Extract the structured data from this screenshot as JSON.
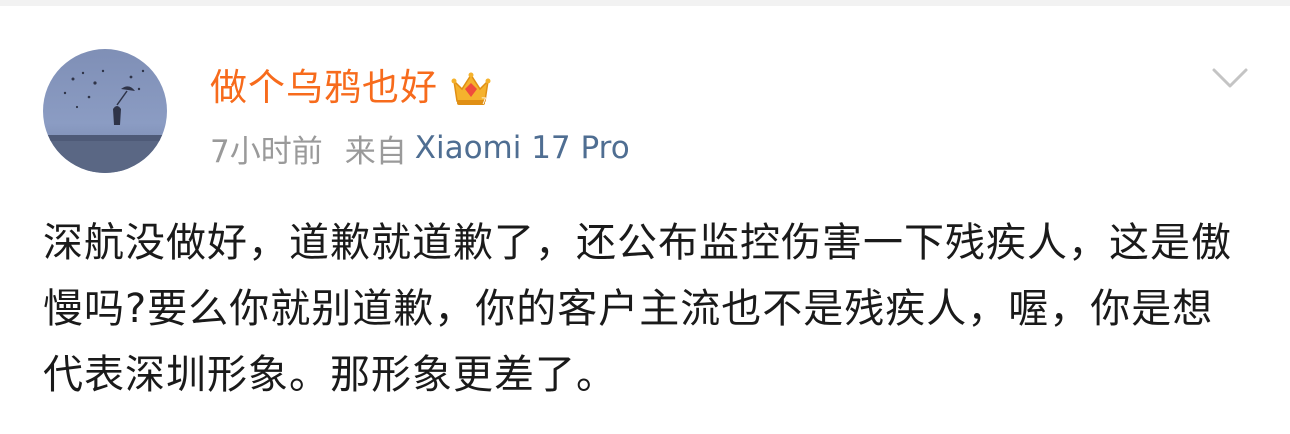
{
  "post": {
    "author": {
      "name": "做个乌鸦也好",
      "avatar": "avatar-image",
      "badge_icon": "crown-icon"
    },
    "meta": {
      "time": "7小时前",
      "source_prefix": "来自",
      "device": "Xiaomi 17 Pro"
    },
    "menu_icon": "chevron-down-icon",
    "text": "深航没做好，道歉就道歉了，还公布监控伤害一下残疾人，这是傲慢吗?要么你就别道歉，你的客户主流也不是残疾人，喔，你是想代表深圳形象。那形象更差了。"
  },
  "colors": {
    "username": "#f76b1c",
    "meta_text": "#9a9a9a",
    "device_link": "#4f6e92",
    "body_text": "#1a1a1a"
  }
}
